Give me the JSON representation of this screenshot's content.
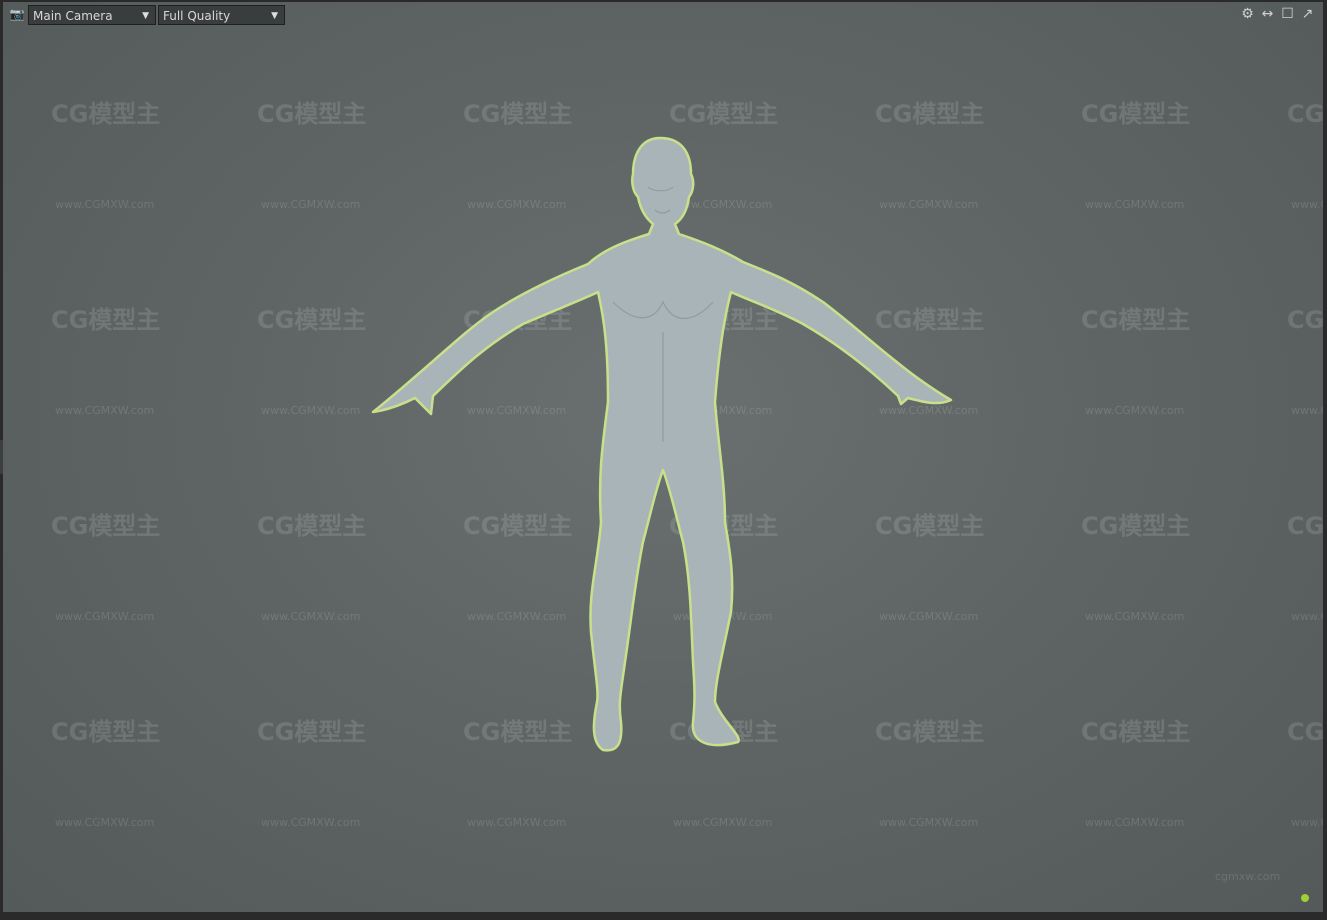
{
  "toolbar": {
    "camera_icon": "camera-icon",
    "camera_select": {
      "value": "Main Camera"
    },
    "quality_select": {
      "value": "Full Quality"
    },
    "right_icons": [
      "gear-icon",
      "split-icon",
      "maximize-icon",
      "popout-icon"
    ]
  },
  "viewport": {
    "watermark_logo": "CG模型主",
    "watermark_url": "www.CGMXW.com",
    "corner_watermark_url": "cgmxw.com",
    "status_color": "#9fd035",
    "model_color": "#a9b4b8",
    "selection_outline_color": "#c8e08a"
  }
}
